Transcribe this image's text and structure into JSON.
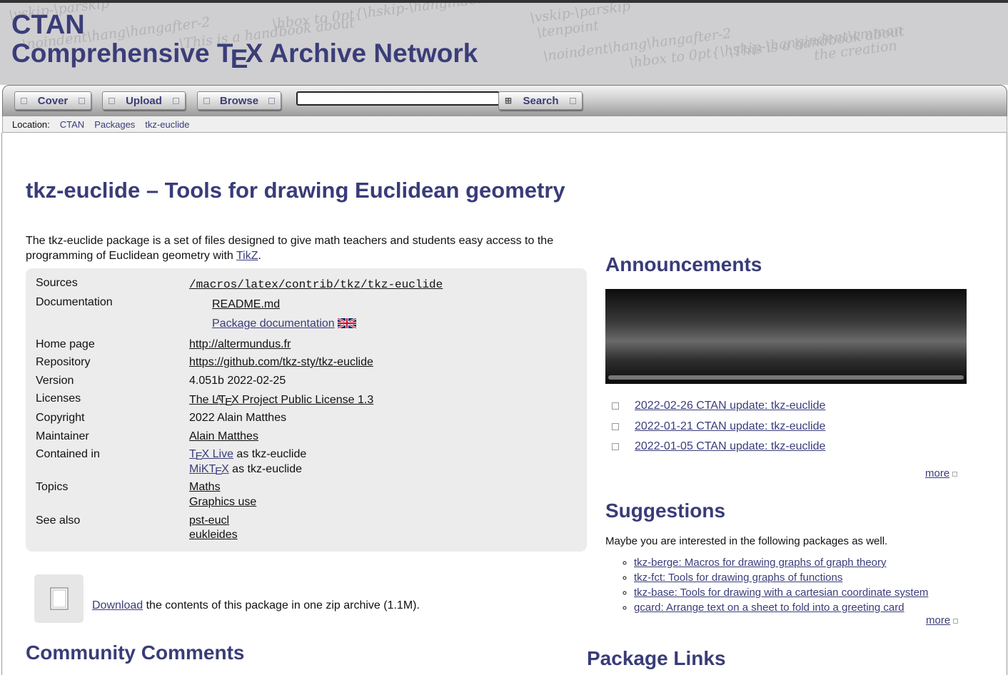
{
  "header": {
    "site_name": "CTAN",
    "subtitle_pre": "Comprehensive T",
    "subtitle_e": "E",
    "subtitle_post": "X Archive Network",
    "watermark": [
      "\\vskip-\\parskip",
      "\\tenpoint",
      "\\noindent\\hang\\hangafter-2",
      "\\hbox to 0pt{\\hskip-\\hangindent\\cmman",
      "\\This is a handbook about",
      "the creation"
    ]
  },
  "nav": {
    "cover": "Cover",
    "upload": "Upload",
    "browse": "Browse",
    "search_value": "",
    "search": "Search"
  },
  "location": {
    "label": "Location:",
    "crumbs": [
      "CTAN",
      "Packages",
      "tkz-euclide"
    ]
  },
  "package": {
    "title": "tkz-euclide – Tools for drawing Euclidean geometry",
    "description_pre": "The tkz-euclide package is a set of files designed to give math teachers and students easy access to the programming of Euclidean geometry with ",
    "description_link": "TikZ",
    "description_post": "."
  },
  "info": {
    "sources_label": "Sources",
    "sources": "/macros/latex/contrib/tkz/tkz-euclide",
    "documentation_label": "Documentation",
    "docs": [
      "README.md",
      "Package documentation"
    ],
    "homepage_label": "Home page",
    "homepage": "http://altermundus.fr",
    "repository_label": "Repository",
    "repository": "https://github.com/tkz-sty/tkz-euclide",
    "version_label": "Version",
    "version": "4.051b 2022-02-25",
    "licenses_label": "Licenses",
    "license_pre": "The L",
    "license_a": "A",
    "license_t": "T",
    "license_e": "E",
    "license_post": "X Project Public License 1.3",
    "copyright_label": "Copyright",
    "copyright": "2022 Alain Matthes",
    "maintainer_label": "Maintainer",
    "maintainer": "Alain Matthes",
    "contained_label": "Contained in",
    "texlive_t": "T",
    "texlive_e": "E",
    "texlive_post": "X Live",
    "texlive_suffix": " as tkz-euclide",
    "miktex_pre": "MiKT",
    "miktex_e": "E",
    "miktex_post": "X",
    "miktex_suffix": " as tkz-euclide",
    "topics_label": "Topics",
    "topics": [
      "Maths",
      "Graphics use"
    ],
    "seealso_label": "See also",
    "seealso": [
      "pst-eucl",
      "eukleides"
    ]
  },
  "download": {
    "link": "Download",
    "text": " the contents of this package in one zip archive (1.1M)."
  },
  "announcements": {
    "heading": "Announcements",
    "items": [
      "2022-02-26 CTAN update: tkz-euclide",
      "2022-01-21 CTAN update: tkz-euclide",
      "2022-01-05 CTAN update: tkz-euclide"
    ],
    "more": "more"
  },
  "suggestions": {
    "heading": "Suggestions",
    "intro": "Maybe you are interested in the following packages as well.",
    "items": [
      "tkz-berge: Macros for drawing graphs of graph theory",
      "tkz-fct: Tools for drawing graphs of functions",
      "tkz-base: Tools for drawing with a cartesian coordinate system",
      "gcard: Arrange text on a sheet to fold into a greeting card"
    ],
    "more": "more"
  },
  "community": {
    "heading": "Community Comments"
  },
  "package_links": {
    "heading": "Package Links"
  },
  "colors": {
    "accent": "#393c78",
    "link": "#3a3d7a",
    "header_bg": "#cfcfd2",
    "panel_bg": "#ececec"
  }
}
